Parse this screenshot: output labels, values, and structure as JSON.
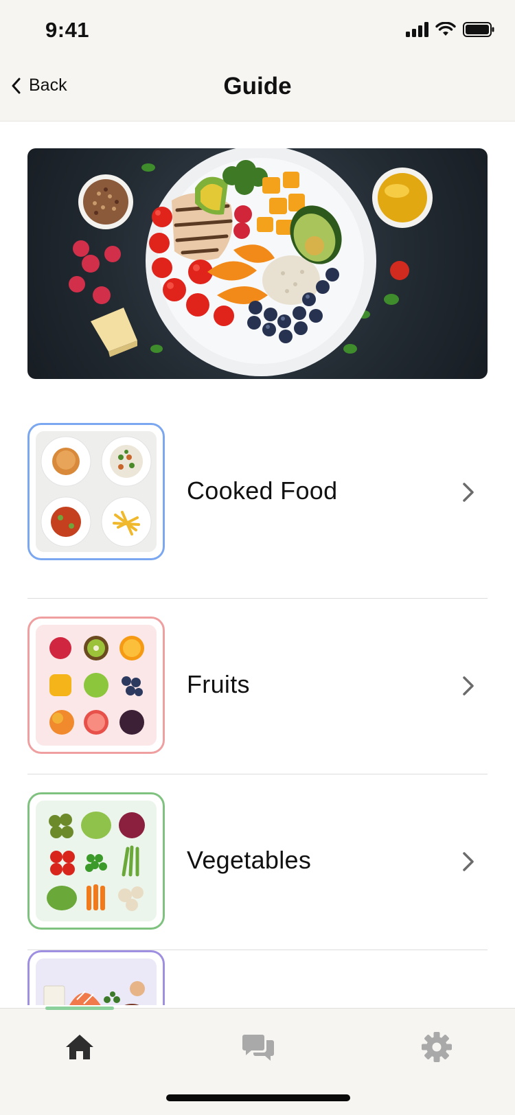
{
  "status_bar": {
    "time": "9:41"
  },
  "nav": {
    "back_label": "Back",
    "title": "Guide"
  },
  "hero": {
    "image": "balanced-meal-plate"
  },
  "categories": [
    {
      "label": "Cooked Food",
      "image": "cooked-dishes-grid",
      "accent": "#7aa7ef"
    },
    {
      "label": "Fruits",
      "image": "fruits-grid",
      "accent": "#ef9f9f"
    },
    {
      "label": "Vegetables",
      "image": "vegetables-grid",
      "accent": "#7fc27f"
    },
    {
      "label": "",
      "image": "protein-foods-grid",
      "accent": "#9f8fe0"
    }
  ],
  "tabbar": {
    "tabs": [
      {
        "name": "home",
        "icon": "home-icon",
        "active": true
      },
      {
        "name": "chat",
        "icon": "chat-icon",
        "active": false
      },
      {
        "name": "settings",
        "icon": "gear-icon",
        "active": false
      }
    ],
    "active_color": "#8cd19b"
  }
}
